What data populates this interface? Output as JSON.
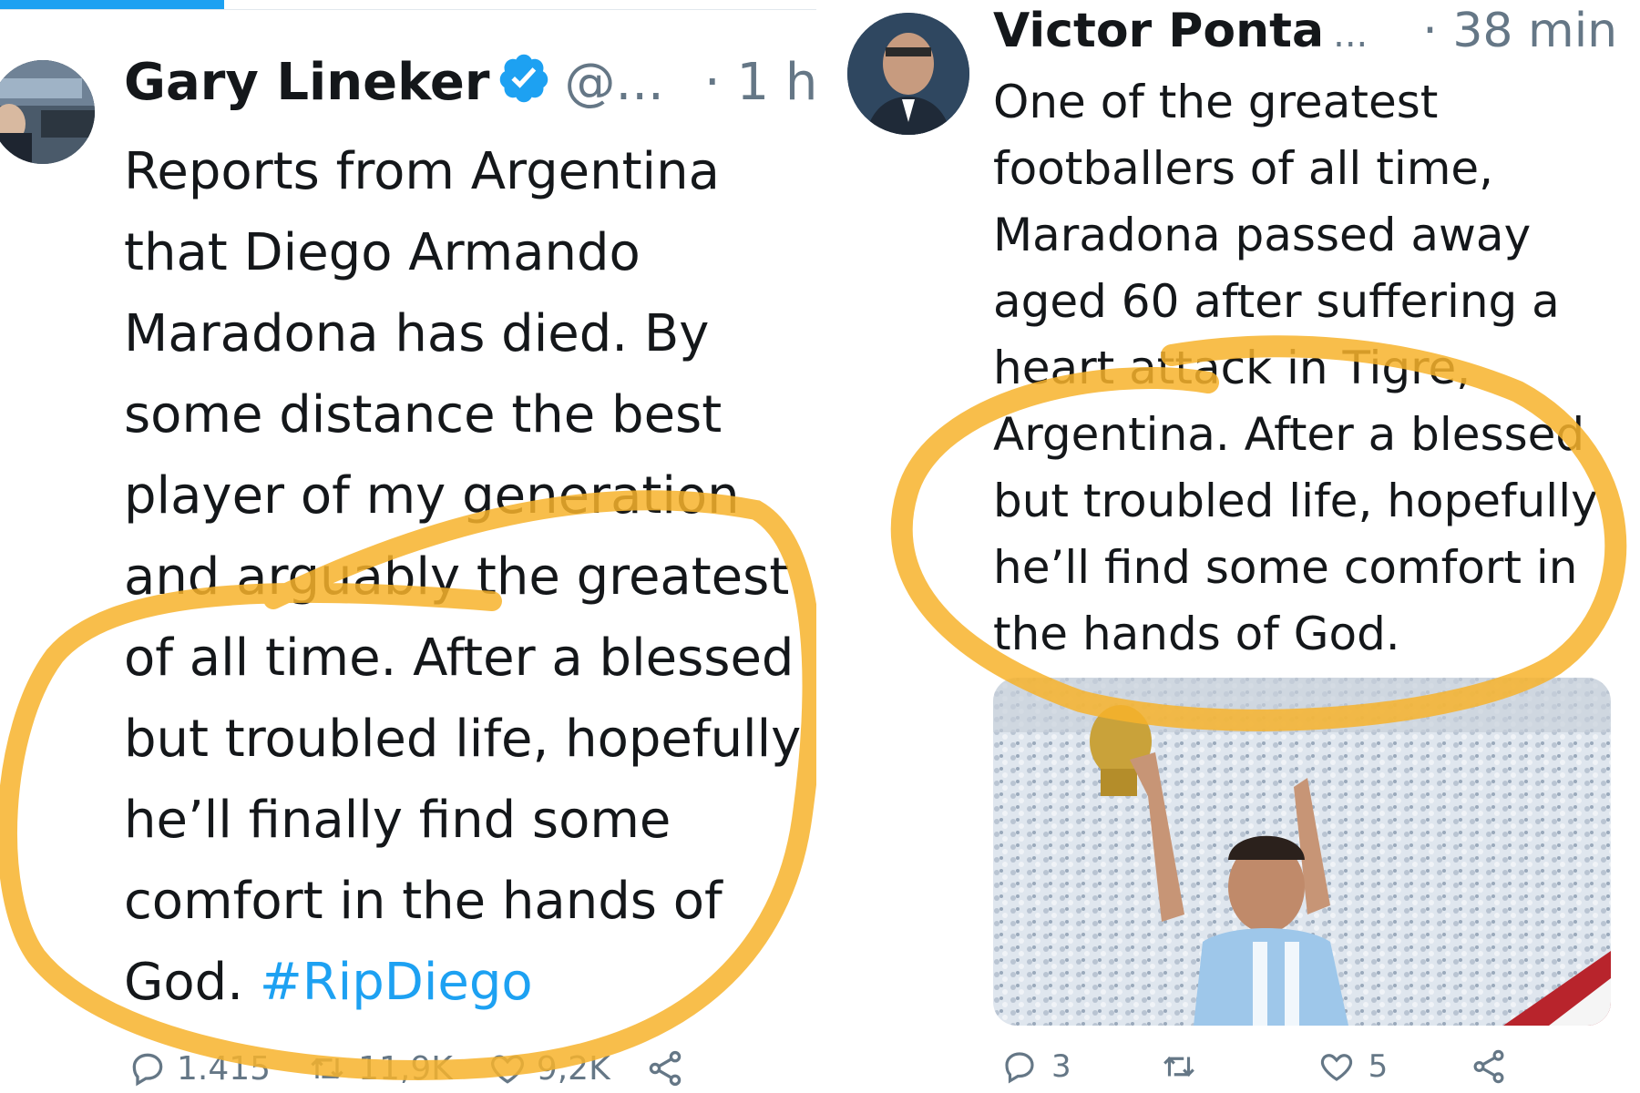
{
  "left_tweet": {
    "author_name": "Gary Lineker",
    "handle": "@...",
    "time": "· 1 h",
    "verified": true,
    "text_lines": [
      "Reports from Argentina",
      "that Diego Armando",
      "Maradona has died. By",
      "some distance the best",
      "player of my generation",
      "and arguably the greatest",
      "of all time. After a blessed",
      "but troubled life, hopefully",
      "he’ll finally find some",
      "comfort in the hands of"
    ],
    "last_line_prefix": "God. ",
    "hashtag": "#RipDiego",
    "actions": {
      "replies": "1.415",
      "retweets": "11,9K",
      "likes": "9,2K"
    }
  },
  "right_tweet": {
    "author_name": "Victor Ponta",
    "name_truncation": "...",
    "time": "· 38 min",
    "text_lines": [
      "One of the greatest",
      "footballers of all time,",
      "Maradona passed away",
      "aged 60 after suffering a",
      "heart attack in Tigre,",
      "Argentina. After a blessed",
      "but troubled life, hopefully",
      "he’ll find some comfort in",
      "the hands of God."
    ],
    "actions": {
      "replies": "3",
      "likes": "5"
    }
  },
  "colors": {
    "text": "#14171a",
    "muted": "#657786",
    "link": "#1da1f2",
    "highlighter": "#f7b32b"
  },
  "icons": [
    "verified-badge-icon",
    "chevron-down-icon",
    "reply-icon",
    "retweet-icon",
    "like-icon",
    "share-icon"
  ]
}
